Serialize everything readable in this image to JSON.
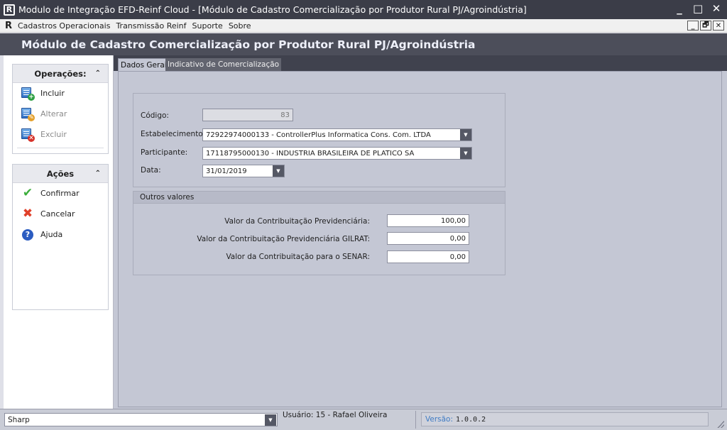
{
  "window": {
    "logo": "R",
    "title": "Modulo de Integração EFD-Reinf Cloud - [Módulo de Cadastro Comercialização por Produtor Rural PJ/Agroindústria]",
    "minimize": "_",
    "maximize": "□",
    "close": "✕"
  },
  "menubar": {
    "logo": "R",
    "items": [
      "Cadastros Operacionais",
      "Transmissão Reinf",
      "Suporte",
      "Sobre"
    ],
    "mdi": [
      "_",
      "🗗",
      "✕"
    ]
  },
  "module_title": "Módulo de Cadastro Comercialização por Produtor Rural PJ/Agroindústria",
  "sidebar": {
    "operacoes": {
      "title": "Operações:",
      "chevron": "⌃",
      "items": [
        {
          "label": "Incluir",
          "icon": "add-document-icon",
          "badge": "+"
        },
        {
          "label": "Alterar",
          "icon": "edit-document-icon",
          "badge": "✎"
        },
        {
          "label": "Excluir",
          "icon": "delete-document-icon",
          "badge": "✕"
        }
      ]
    },
    "acoes": {
      "title": "Ações",
      "chevron": "⌃",
      "items": [
        {
          "label": "Confirmar",
          "icon": "checkmark-icon",
          "glyph": "✔"
        },
        {
          "label": "Cancelar",
          "icon": "cross-icon",
          "glyph": "✖"
        },
        {
          "label": "Ajuda",
          "icon": "help-shield-icon",
          "glyph": "?"
        }
      ]
    }
  },
  "tabs": [
    {
      "label": "Dados Gerais",
      "active": true
    },
    {
      "label": "Indicativo de Comercialização",
      "active": false
    }
  ],
  "form": {
    "codigo": {
      "label": "Código:",
      "value": "83"
    },
    "estabelecimento": {
      "label": "Estabelecimento:",
      "value": "72922974000133 - ControllerPlus Informatica Cons. Com. LTDA"
    },
    "participante": {
      "label": "Participante:",
      "value": "17118795000130 - INDUSTRIA BRASILEIRA DE PLATICO SA"
    },
    "data": {
      "label": "Data:",
      "value": "31/01/2019"
    },
    "dropdown_arrow": "▼"
  },
  "outros_valores": {
    "title": "Outros valores",
    "fields": [
      {
        "label": "Valor da Contribuitação Previdenciária:",
        "value": "100,00"
      },
      {
        "label": "Valor da Contribuitação Previdenciária GILRAT:",
        "value": "0,00"
      },
      {
        "label": "Valor da Contribuitação para o SENAR:",
        "value": "0,00"
      }
    ]
  },
  "statusbar": {
    "theme": "Sharp",
    "user": "Usuário: 15 - Rafael Oliveira",
    "version_label": "Versão:",
    "version": "1.0.0.2"
  },
  "colors": {
    "titlebar": "#3b3d48",
    "module_header": "#4c4e5a",
    "content_bg": "#c4c7d4",
    "accent_blue": "#3f7bc4"
  }
}
